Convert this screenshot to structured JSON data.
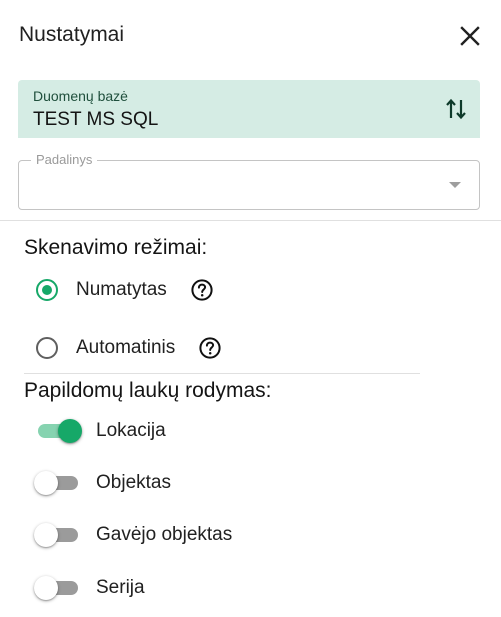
{
  "dialog": {
    "title": "Nustatymai"
  },
  "database": {
    "label": "Duomenų bazė",
    "value": "TEST MS SQL"
  },
  "department": {
    "label": "Padalinys",
    "value": ""
  },
  "scan_modes": {
    "title": "Skenavimo režimai:",
    "options": [
      {
        "label": "Numatytas",
        "checked": true
      },
      {
        "label": "Automatinis",
        "checked": false
      }
    ]
  },
  "extra_fields": {
    "title": "Papildomų laukų rodymas:",
    "toggles": [
      {
        "label": "Lokacija",
        "on": true
      },
      {
        "label": "Objektas",
        "on": false
      },
      {
        "label": "Gavėjo objektas",
        "on": false
      },
      {
        "label": "Serija",
        "on": false
      }
    ]
  },
  "colors": {
    "accent": "#16a868",
    "accent_light": "#86d3b0",
    "db_background": "#d5ece4",
    "off_track": "#9b9b9b"
  },
  "icons": {
    "close": "close-icon",
    "swap": "swap-vertical-icon",
    "dropdown": "chevron-down-icon",
    "help": "help-circle-icon"
  }
}
